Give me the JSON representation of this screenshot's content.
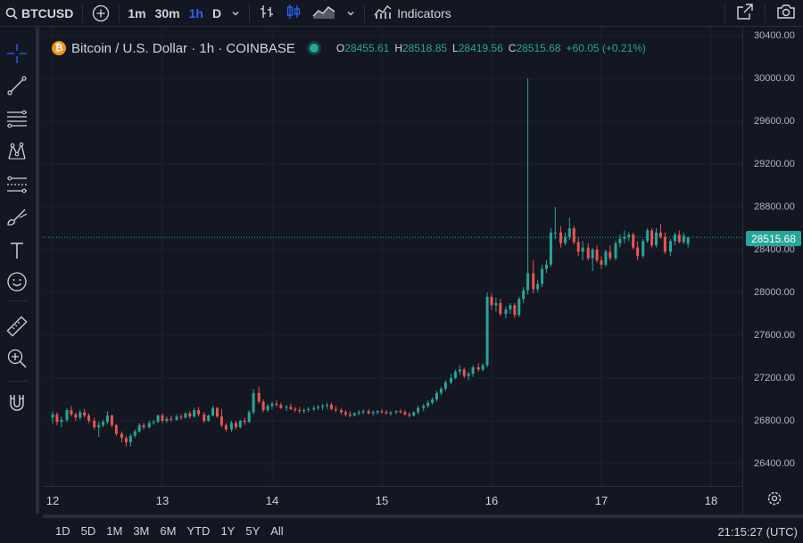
{
  "toolbar": {
    "symbol": "BTCUSD",
    "timeframes": [
      "1m",
      "30m",
      "1h",
      "D"
    ],
    "active_timeframe": "1h",
    "indicators_label": "Indicators"
  },
  "legend": {
    "badge": "₿",
    "title": "Bitcoin / U.S. Dollar · 1h · COINBASE",
    "ohlc": {
      "open_key": "O",
      "open": "28455.61",
      "high_key": "H",
      "high": "28518.85",
      "low_key": "L",
      "low": "28419.56",
      "close_key": "C",
      "close": "28515.68",
      "change": "+60.05 (+0.21%)"
    }
  },
  "price_axis": {
    "labels": [
      "30400.00",
      "30000.00",
      "29600.00",
      "29200.00",
      "28800.00",
      "28400.00",
      "28000.00",
      "27600.00",
      "27200.00",
      "26800.00",
      "26400.00"
    ],
    "last_price": "28515.68"
  },
  "time_axis": {
    "labels": [
      "12",
      "13",
      "14",
      "15",
      "16",
      "17",
      "18"
    ]
  },
  "bottombar": {
    "ranges": [
      "1D",
      "5D",
      "1M",
      "3M",
      "6M",
      "YTD",
      "1Y",
      "5Y",
      "All"
    ],
    "clock": "21:15:27 (UTC)"
  },
  "colors": {
    "up": "#26a69a",
    "down": "#ef5350",
    "background": "#131722",
    "grid": "#1e222d",
    "accent": "#2962ff"
  },
  "chart_data": {
    "type": "candlestick",
    "series_name": "BTCUSD",
    "timeframe": "1h",
    "x_unit": "day of month",
    "ylim": [
      26200,
      30500
    ],
    "last_price": 28515.68,
    "candles": [
      [
        12.0,
        26830,
        26890,
        26770,
        26860
      ],
      [
        12.04,
        26860,
        26880,
        26760,
        26790
      ],
      [
        12.08,
        26790,
        26840,
        26740,
        26810
      ],
      [
        12.13,
        26810,
        26920,
        26790,
        26900
      ],
      [
        12.17,
        26900,
        26940,
        26840,
        26860
      ],
      [
        12.21,
        26860,
        26880,
        26800,
        26830
      ],
      [
        12.25,
        26830,
        26900,
        26810,
        26880
      ],
      [
        12.29,
        26880,
        26910,
        26830,
        26850
      ],
      [
        12.33,
        26850,
        26870,
        26780,
        26800
      ],
      [
        12.38,
        26800,
        26830,
        26720,
        26740
      ],
      [
        12.42,
        26740,
        26790,
        26650,
        26760
      ],
      [
        12.46,
        26760,
        26810,
        26740,
        26790
      ],
      [
        12.5,
        26790,
        26890,
        26770,
        26850
      ],
      [
        12.54,
        26850,
        26860,
        26740,
        26760
      ],
      [
        12.58,
        26760,
        26770,
        26660,
        26680
      ],
      [
        12.63,
        26680,
        26700,
        26600,
        26640
      ],
      [
        12.67,
        26640,
        26660,
        26560,
        26600
      ],
      [
        12.71,
        26600,
        26680,
        26560,
        26660
      ],
      [
        12.75,
        26660,
        26720,
        26640,
        26700
      ],
      [
        12.79,
        26700,
        26780,
        26690,
        26760
      ],
      [
        12.83,
        26760,
        26780,
        26720,
        26740
      ],
      [
        12.88,
        26740,
        26800,
        26730,
        26780
      ],
      [
        12.92,
        26780,
        26810,
        26760,
        26790
      ],
      [
        12.96,
        26790,
        26860,
        26780,
        26850
      ],
      [
        13.0,
        26850,
        26870,
        26780,
        26800
      ],
      [
        13.04,
        26800,
        26840,
        26780,
        26820
      ],
      [
        13.08,
        26820,
        26850,
        26790,
        26810
      ],
      [
        13.13,
        26810,
        26860,
        26800,
        26840
      ],
      [
        13.17,
        26840,
        26860,
        26810,
        26830
      ],
      [
        13.21,
        26830,
        26880,
        26820,
        26870
      ],
      [
        13.25,
        26870,
        26890,
        26820,
        26840
      ],
      [
        13.29,
        26840,
        26920,
        26830,
        26900
      ],
      [
        13.33,
        26900,
        26930,
        26840,
        26860
      ],
      [
        13.38,
        26860,
        26880,
        26780,
        26800
      ],
      [
        13.42,
        26800,
        26860,
        26790,
        26850
      ],
      [
        13.46,
        26850,
        26940,
        26840,
        26920
      ],
      [
        13.5,
        26920,
        26930,
        26830,
        26840
      ],
      [
        13.54,
        26840,
        26910,
        26740,
        26760
      ],
      [
        13.58,
        26760,
        26780,
        26700,
        26720
      ],
      [
        13.63,
        26720,
        26800,
        26700,
        26780
      ],
      [
        13.67,
        26780,
        26800,
        26720,
        26740
      ],
      [
        13.71,
        26740,
        26810,
        26730,
        26800
      ],
      [
        13.75,
        26800,
        26830,
        26760,
        26790
      ],
      [
        13.79,
        26790,
        26900,
        26780,
        26880
      ],
      [
        13.83,
        26880,
        27100,
        26860,
        27060
      ],
      [
        13.88,
        27060,
        27120,
        26960,
        26980
      ],
      [
        13.92,
        26980,
        27000,
        26880,
        26900
      ],
      [
        13.96,
        26900,
        26960,
        26880,
        26940
      ],
      [
        14.0,
        26940,
        26980,
        26910,
        26960
      ],
      [
        14.04,
        26960,
        26990,
        26930,
        26950
      ],
      [
        14.08,
        26950,
        26970,
        26910,
        26920
      ],
      [
        14.13,
        26920,
        26950,
        26890,
        26930
      ],
      [
        14.17,
        26930,
        26960,
        26900,
        26910
      ],
      [
        14.21,
        26910,
        26930,
        26880,
        26900
      ],
      [
        14.25,
        26900,
        26930,
        26870,
        26890
      ],
      [
        14.29,
        26890,
        26920,
        26870,
        26900
      ],
      [
        14.33,
        26900,
        26930,
        26880,
        26910
      ],
      [
        14.38,
        26910,
        26940,
        26890,
        26920
      ],
      [
        14.42,
        26920,
        26950,
        26900,
        26930
      ],
      [
        14.46,
        26930,
        26960,
        26900,
        26940
      ],
      [
        14.5,
        26940,
        26970,
        26910,
        26950
      ],
      [
        14.54,
        26950,
        26970,
        26900,
        26910
      ],
      [
        14.58,
        26910,
        26940,
        26880,
        26900
      ],
      [
        14.63,
        26900,
        26920,
        26860,
        26880
      ],
      [
        14.67,
        26880,
        26900,
        26840,
        26860
      ],
      [
        14.71,
        26860,
        26890,
        26830,
        26850
      ],
      [
        14.75,
        26850,
        26880,
        26840,
        26870
      ],
      [
        14.79,
        26870,
        26900,
        26850,
        26880
      ],
      [
        14.83,
        26880,
        26910,
        26860,
        26890
      ],
      [
        14.88,
        26890,
        26910,
        26860,
        26870
      ],
      [
        14.92,
        26870,
        26900,
        26850,
        26880
      ],
      [
        14.96,
        26880,
        26900,
        26860,
        26890
      ],
      [
        15.0,
        26890,
        26910,
        26870,
        26880
      ],
      [
        15.04,
        26880,
        26900,
        26860,
        26870
      ],
      [
        15.08,
        26870,
        26890,
        26850,
        26880
      ],
      [
        15.13,
        26880,
        26900,
        26860,
        26890
      ],
      [
        15.17,
        26890,
        26910,
        26870,
        26880
      ],
      [
        15.21,
        26880,
        26900,
        26850,
        26860
      ],
      [
        15.25,
        26860,
        26880,
        26830,
        26850
      ],
      [
        15.29,
        26850,
        26890,
        26840,
        26880
      ],
      [
        15.33,
        26880,
        26940,
        26860,
        26920
      ],
      [
        15.38,
        26920,
        26960,
        26890,
        26940
      ],
      [
        15.42,
        26940,
        26990,
        26920,
        26970
      ],
      [
        15.46,
        26970,
        27020,
        26950,
        27000
      ],
      [
        15.5,
        27000,
        27080,
        26980,
        27060
      ],
      [
        15.54,
        27060,
        27120,
        27040,
        27100
      ],
      [
        15.58,
        27100,
        27180,
        27080,
        27160
      ],
      [
        15.63,
        27160,
        27240,
        27140,
        27200
      ],
      [
        15.67,
        27200,
        27280,
        27190,
        27260
      ],
      [
        15.71,
        27260,
        27320,
        27230,
        27280
      ],
      [
        15.75,
        27280,
        27300,
        27200,
        27220
      ],
      [
        15.79,
        27220,
        27260,
        27180,
        27240
      ],
      [
        15.83,
        27240,
        27320,
        27210,
        27300
      ],
      [
        15.88,
        27300,
        27340,
        27260,
        27280
      ],
      [
        15.92,
        27280,
        27340,
        27260,
        27320
      ],
      [
        15.96,
        27320,
        28000,
        27300,
        27960
      ],
      [
        16.0,
        27960,
        27990,
        27840,
        27880
      ],
      [
        16.04,
        27880,
        27950,
        27820,
        27900
      ],
      [
        16.08,
        27900,
        27940,
        27780,
        27800
      ],
      [
        16.13,
        27800,
        27870,
        27760,
        27840
      ],
      [
        16.17,
        27840,
        27900,
        27800,
        27880
      ],
      [
        16.21,
        27880,
        27900,
        27760,
        27790
      ],
      [
        16.25,
        27790,
        27960,
        27770,
        27940
      ],
      [
        16.29,
        27940,
        28050,
        27900,
        28020
      ],
      [
        16.33,
        28020,
        30000,
        27980,
        28180
      ],
      [
        16.38,
        28180,
        28300,
        27990,
        28030
      ],
      [
        16.42,
        28030,
        28120,
        28000,
        28080
      ],
      [
        16.46,
        28080,
        28260,
        28050,
        28220
      ],
      [
        16.5,
        28220,
        28300,
        28180,
        28260
      ],
      [
        16.54,
        28260,
        28600,
        28240,
        28560
      ],
      [
        16.58,
        28560,
        28800,
        28500,
        28560
      ],
      [
        16.63,
        28560,
        28620,
        28420,
        28460
      ],
      [
        16.67,
        28460,
        28560,
        28440,
        28520
      ],
      [
        16.71,
        28520,
        28700,
        28490,
        28600
      ],
      [
        16.75,
        28600,
        28620,
        28450,
        28470
      ],
      [
        16.79,
        28470,
        28520,
        28340,
        28380
      ],
      [
        16.83,
        28380,
        28480,
        28300,
        28420
      ],
      [
        16.88,
        28420,
        28460,
        28300,
        28320
      ],
      [
        16.92,
        28320,
        28420,
        28200,
        28400
      ],
      [
        16.96,
        28400,
        28440,
        28280,
        28300
      ],
      [
        17.0,
        28300,
        28340,
        28220,
        28260
      ],
      [
        17.04,
        28260,
        28400,
        28240,
        28380
      ],
      [
        17.08,
        28380,
        28440,
        28300,
        28320
      ],
      [
        17.13,
        28320,
        28480,
        28300,
        28460
      ],
      [
        17.17,
        28460,
        28540,
        28420,
        28500
      ],
      [
        17.21,
        28500,
        28580,
        28460,
        28520
      ],
      [
        17.25,
        28520,
        28560,
        28480,
        28540
      ],
      [
        17.29,
        28540,
        28560,
        28400,
        28420
      ],
      [
        17.33,
        28420,
        28480,
        28300,
        28340
      ],
      [
        17.38,
        28340,
        28500,
        28320,
        28480
      ],
      [
        17.42,
        28480,
        28600,
        28460,
        28580
      ],
      [
        17.46,
        28580,
        28600,
        28420,
        28440
      ],
      [
        17.5,
        28440,
        28600,
        28420,
        28560
      ],
      [
        17.54,
        28560,
        28640,
        28500,
        28520
      ],
      [
        17.58,
        28520,
        28560,
        28360,
        28380
      ],
      [
        17.63,
        28380,
        28500,
        28340,
        28480
      ],
      [
        17.67,
        28480,
        28560,
        28440,
        28540
      ],
      [
        17.71,
        28540,
        28580,
        28460,
        28470
      ],
      [
        17.75,
        28470,
        28560,
        28450,
        28530
      ],
      [
        17.79,
        28455.61,
        28518.85,
        28419.56,
        28515.68
      ]
    ]
  }
}
